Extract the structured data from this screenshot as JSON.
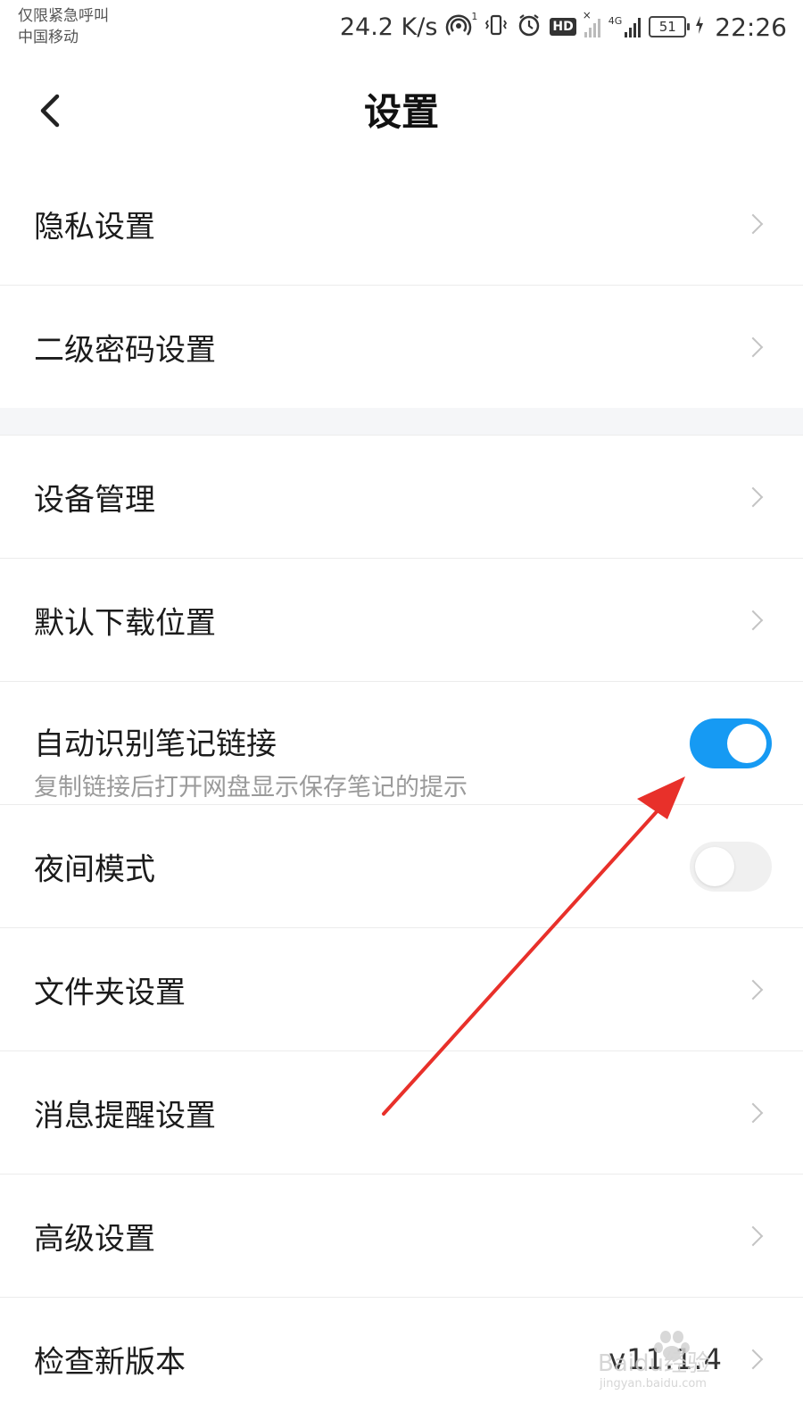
{
  "status_bar": {
    "carrier_line1": "仅限紧急呼叫",
    "carrier_line2": "中国移动",
    "net_speed": "24.2 K/s",
    "hotspot_badge": "1",
    "hd_label": "HD",
    "network_label": "4G",
    "battery_level": "51",
    "time": "22:26"
  },
  "header": {
    "title": "设置"
  },
  "settings": {
    "privacy": "隐私设置",
    "secondary_password": "二级密码设置",
    "device_management": "设备管理",
    "default_download_location": "默认下载位置",
    "auto_detect_note_links": "自动识别笔记链接",
    "auto_detect_note_links_desc": "复制链接后打开网盘显示保存笔记的提示",
    "auto_detect_note_links_on": true,
    "night_mode": "夜间模式",
    "night_mode_on": false,
    "folder_settings": "文件夹设置",
    "message_reminder": "消息提醒设置",
    "advanced": "高级设置",
    "check_new_version": "检查新版本",
    "version_text": "v11.1.4"
  },
  "watermark": {
    "brand": "Baidu经验",
    "url": "jingyan.baidu.com"
  },
  "colors": {
    "accent": "#169af3",
    "annotation_arrow": "#e8302a",
    "divider": "#ececec",
    "section_gap": "#f5f6f8"
  }
}
